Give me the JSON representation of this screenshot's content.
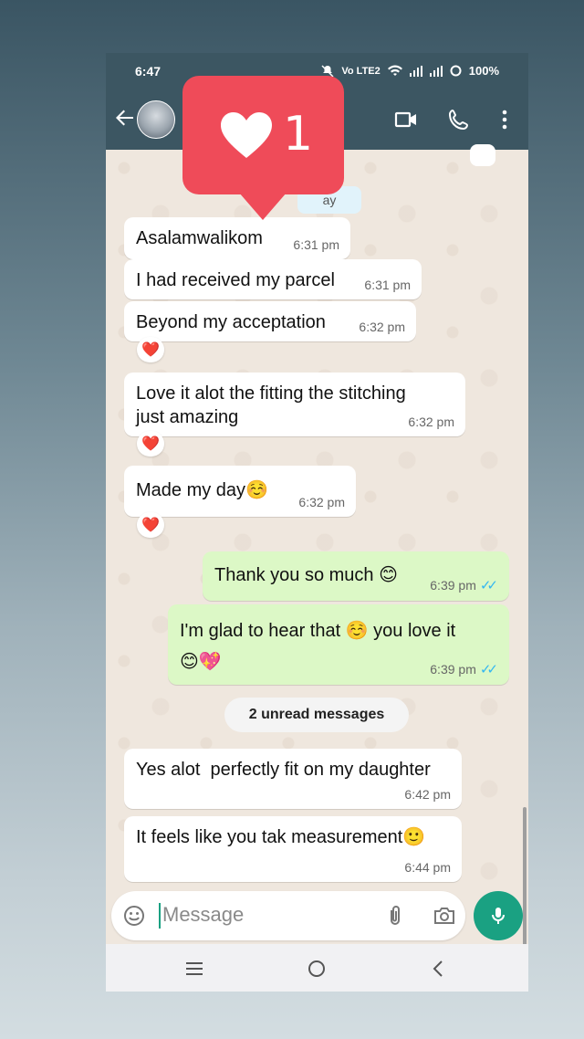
{
  "status_bar": {
    "time": "6:47",
    "network": "Vo LTE2",
    "battery": "100%"
  },
  "header": {
    "back_icon": "arrow-left-icon",
    "avatar": "contact-avatar",
    "video_icon": "video-call-icon",
    "call_icon": "phone-icon",
    "menu_icon": "more-vert-icon"
  },
  "overlay": {
    "like_count": "1",
    "icon": "heart-icon",
    "color": "#ef4b59"
  },
  "chat": {
    "day_label_partial": "ay",
    "unread_label": "2 unread messages",
    "messages": [
      {
        "text": "Asalamwalikom",
        "time": "6:31 pm",
        "direction": "incoming"
      },
      {
        "text": "I had received my parcel",
        "time": "6:31 pm",
        "direction": "incoming"
      },
      {
        "text": "Beyond my acceptation",
        "time": "6:32 pm",
        "direction": "incoming",
        "reaction": "❤️"
      },
      {
        "text": "Love it alot the fitting the stitching\njust amazing",
        "time": "6:32 pm",
        "direction": "incoming",
        "reaction": "❤️"
      },
      {
        "text": "Made my day☺️",
        "time": "6:32 pm",
        "direction": "incoming",
        "reaction": "❤️"
      },
      {
        "text": "Thank you so much 😊",
        "time": "6:39 pm",
        "direction": "outgoing",
        "read": true
      },
      {
        "text": "I'm glad to hear that ☺️ you love it\n😊💖",
        "time": "6:39 pm",
        "direction": "outgoing",
        "read": true
      },
      {
        "text": "Yes alot  perfectly fit on my daughter",
        "time": "6:42 pm",
        "direction": "incoming"
      },
      {
        "text": "It feels like you tak measurement🙂",
        "time": "6:44 pm",
        "direction": "incoming"
      }
    ]
  },
  "composer": {
    "placeholder": "Message",
    "emoji_icon": "emoji-icon",
    "attach_icon": "paperclip-icon",
    "camera_icon": "camera-icon",
    "mic_icon": "microphone-icon",
    "accent": "#1aa182"
  },
  "nav": {
    "recent_icon": "recent-apps-icon",
    "home_icon": "home-icon",
    "back_icon": "nav-back-icon"
  }
}
